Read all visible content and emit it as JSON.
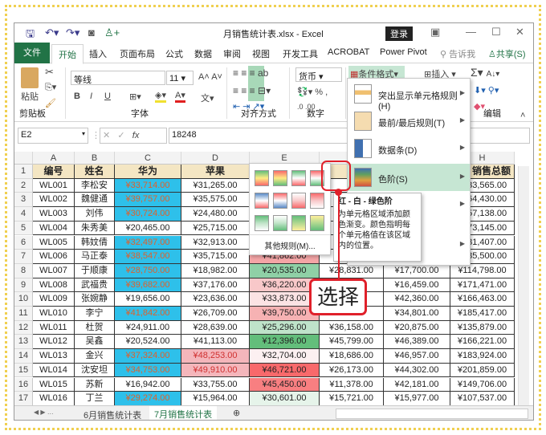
{
  "title": "月销售统计表.xlsx  -  Excel",
  "login": "登录",
  "tabs": [
    "文件",
    "开始",
    "插入",
    "页面布局",
    "公式",
    "数据",
    "审阅",
    "视图",
    "开发工具",
    "ACROBAT",
    "Power Pivot"
  ],
  "tell_me": "告诉我",
  "share": "共享(S)",
  "ribbon": {
    "paste": "粘贴",
    "clipboard": "剪贴板",
    "font_name": "等线",
    "font_size": "11",
    "font": "字体",
    "alignment": "对齐方式",
    "number_format": "货币",
    "number": "数字",
    "cond_format": "条件格式",
    "insert": "插入",
    "editing": "编辑",
    "bold": "B",
    "italic": "I",
    "underline": "U",
    "percent": "%"
  },
  "name_box": "E2",
  "formula": "18248",
  "columns": [
    "A",
    "B",
    "C",
    "D",
    "E",
    "F",
    "G",
    "H"
  ],
  "headers": [
    "编号",
    "姓名",
    "华为",
    "苹果",
    "",
    "",
    "",
    "销售总额"
  ],
  "rows": [
    [
      "WL001",
      "李松安",
      "¥33,714.00",
      "¥31,265.00",
      "",
      "",
      "",
      "¥133,565.00"
    ],
    [
      "WL002",
      "魏健通",
      "¥39,757.00",
      "¥35,575.00",
      "",
      "",
      "",
      "¥164,430.00"
    ],
    [
      "WL003",
      "刘伟",
      "¥30,724.00",
      "¥24,480.00",
      "",
      "",
      "",
      "¥157,138.00"
    ],
    [
      "WL004",
      "朱秀美",
      "¥20,465.00",
      "¥25,715.00",
      "",
      "",
      "",
      "¥173,145.00"
    ],
    [
      "WL005",
      "韩妏倩",
      "¥32,497.00",
      "¥32,913.00",
      "",
      "",
      "",
      "¥131,407.00"
    ],
    [
      "WL006",
      "马正泰",
      "¥38,547.00",
      "¥35,715.00",
      "¥41,862.00",
      "",
      "",
      "¥185,500.00"
    ],
    [
      "WL007",
      "于顺康",
      "¥28,750.00",
      "¥18,982.00",
      "¥20,535.00",
      "¥28,831.00",
      "¥17,700.00",
      "¥114,798.00"
    ],
    [
      "WL008",
      "武福贵",
      "¥39,682.00",
      "¥37,176.00",
      "¥36,220.00",
      "",
      "¥16,459.00",
      "¥171,471.00"
    ],
    [
      "WL009",
      "张婉静",
      "¥19,656.00",
      "¥23,636.00",
      "¥33,873.00",
      "",
      "¥42,360.00",
      "¥166,463.00"
    ],
    [
      "WL010",
      "李宁",
      "¥41,842.00",
      "¥26,709.00",
      "¥39,750.00",
      "",
      "¥34,801.00",
      "¥185,417.00"
    ],
    [
      "WL011",
      "杜贺",
      "¥24,911.00",
      "¥28,639.00",
      "¥25,296.00",
      "¥36,158.00",
      "¥20,875.00",
      "¥135,879.00"
    ],
    [
      "WL012",
      "吴鑫",
      "¥20,524.00",
      "¥41,113.00",
      "¥12,396.00",
      "¥45,799.00",
      "¥46,389.00",
      "¥166,221.00"
    ],
    [
      "WL013",
      "金兴",
      "¥37,324.00",
      "¥48,253.00",
      "¥32,704.00",
      "¥18,686.00",
      "¥46,957.00",
      "¥183,924.00"
    ],
    [
      "WL014",
      "沈安坦",
      "¥34,753.00",
      "¥49,910.00",
      "¥46,721.00",
      "¥26,173.00",
      "¥44,302.00",
      "¥201,859.00"
    ],
    [
      "WL015",
      "苏新",
      "¥16,942.00",
      "¥33,755.00",
      "¥45,450.00",
      "¥11,378.00",
      "¥42,181.00",
      "¥149,706.00"
    ],
    [
      "WL016",
      "丁兰",
      "¥29,274.00",
      "¥15,964.00",
      "¥30,601.00",
      "¥15,721.00",
      "¥15,977.00",
      "¥107,537.00"
    ]
  ],
  "e_colors": [
    "",
    "",
    "",
    "",
    "",
    "#f4a5a6",
    "#8fd0a6",
    "#f8c8c9",
    "#fbe3e4",
    "#f6b2b3",
    "#bfe3ca",
    "#63be7b",
    "#fcf0f1",
    "#f8696b",
    "#f87f81",
    "#e6f4ea"
  ],
  "colors": {
    "c_fill": "#2ec0ea",
    "c_text": "#e0602a",
    "d_fill": "#f4b6bb",
    "d_text": "#d03030",
    "accent": "#217346",
    "menu_hl": "#c6e6d3"
  },
  "sheets": [
    "6月销售统计表",
    "7月销售统计表"
  ],
  "menu": [
    "突出显示单元格规则(H)",
    "最前/最后规则(T)",
    "数据条(D)",
    "色阶(S)"
  ],
  "gallery_more": "其他规则(M)...",
  "tooltip": {
    "title": "红 - 白 - 绿色阶",
    "body": "为单元格区域添加颜色渐变。颜色指明每个单元格值在该区域内的位置。"
  },
  "callout": "选择"
}
